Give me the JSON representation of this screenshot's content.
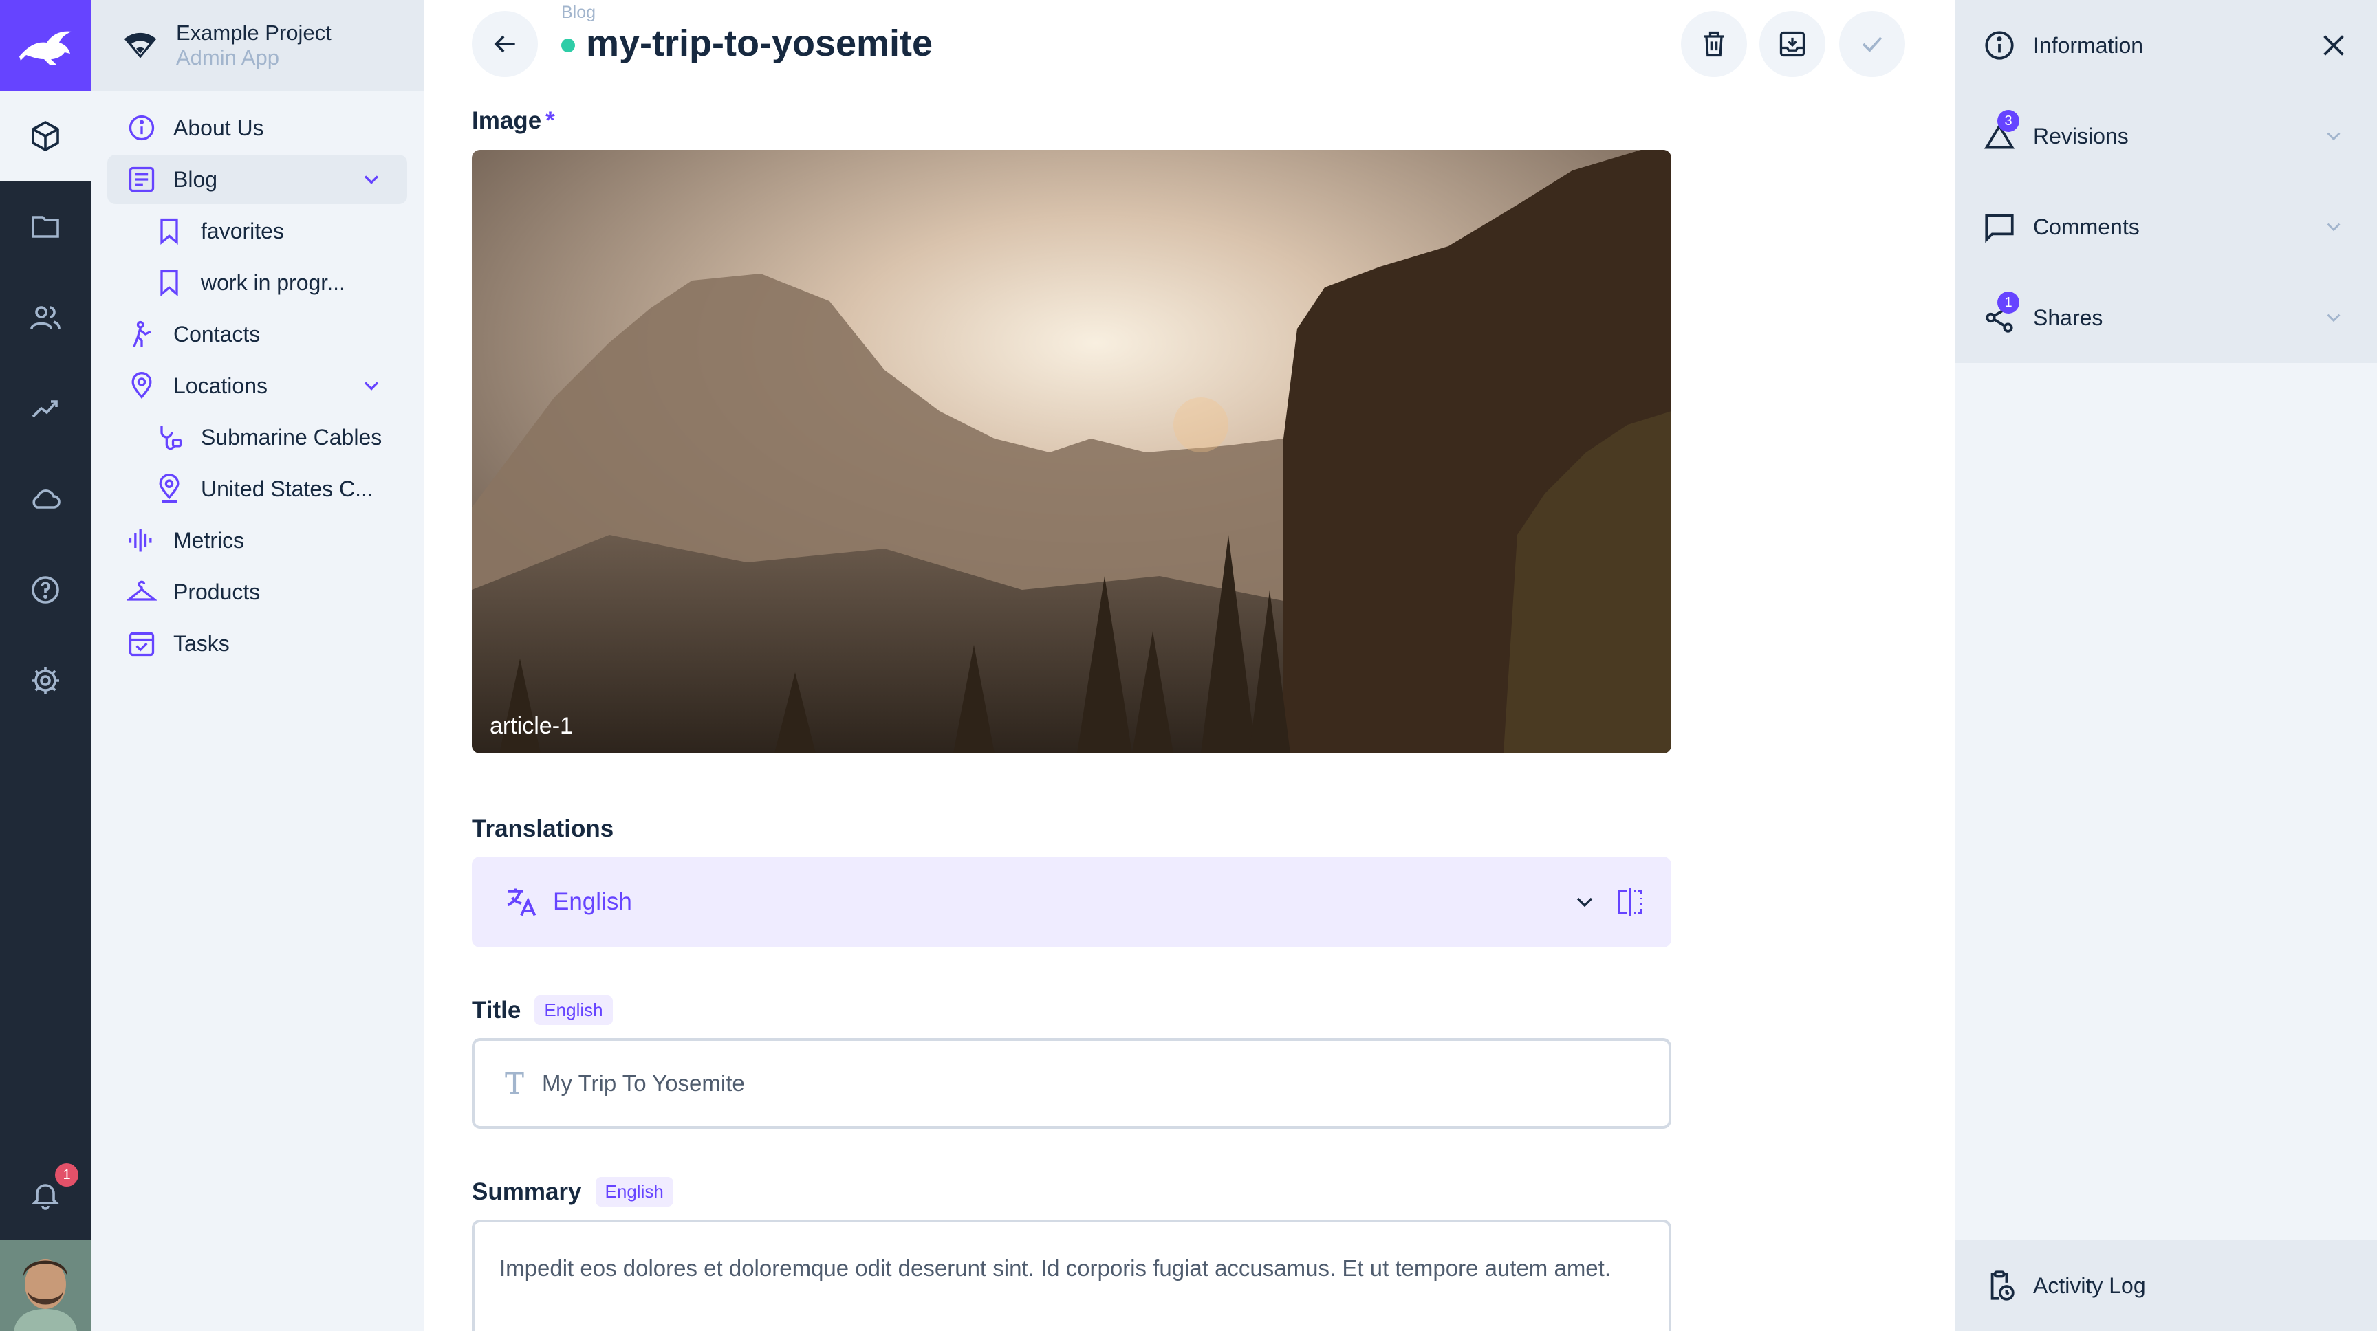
{
  "project": {
    "name": "Example Project",
    "subtitle": "Admin App"
  },
  "modules": [
    {
      "name": "content-module",
      "icon": "cube-icon",
      "active": true
    },
    {
      "name": "files-module",
      "icon": "folder-icon"
    },
    {
      "name": "users-module",
      "icon": "users-icon"
    },
    {
      "name": "insights-module",
      "icon": "insights-icon"
    },
    {
      "name": "cloud-module",
      "icon": "cloud-icon"
    },
    {
      "name": "help-module",
      "icon": "help-icon"
    },
    {
      "name": "settings-module",
      "icon": "gear-icon"
    }
  ],
  "notifications": {
    "count": "1"
  },
  "nav": {
    "items": [
      {
        "label": "About Us"
      },
      {
        "label": "Blog"
      },
      {
        "label": "favorites"
      },
      {
        "label": "work in progr..."
      },
      {
        "label": "Contacts"
      },
      {
        "label": "Locations"
      },
      {
        "label": "Submarine Cables"
      },
      {
        "label": "United States C..."
      },
      {
        "label": "Metrics"
      },
      {
        "label": "Products"
      },
      {
        "label": "Tasks"
      }
    ]
  },
  "header": {
    "breadcrumb": "Blog",
    "title": "my-trip-to-yosemite"
  },
  "form": {
    "image": {
      "label": "Image",
      "required_mark": "*",
      "caption": "article-1"
    },
    "translations": {
      "label": "Translations",
      "language": "English"
    },
    "title": {
      "label": "Title",
      "lang_badge": "English",
      "value": "My Trip To Yosemite"
    },
    "summary": {
      "label": "Summary",
      "lang_badge": "English",
      "value": "Impedit eos dolores et doloremque odit deserunt sint. Id corporis fugiat accusamus. Et ut tempore autem amet."
    }
  },
  "sidebar": {
    "information": "Information",
    "revisions": "Revisions",
    "revisions_count": "3",
    "comments": "Comments",
    "shares": "Shares",
    "shares_count": "1",
    "activity": "Activity Log"
  },
  "colors": {
    "accent": "#6644ff",
    "module_bar": "#1f2937",
    "status_published": "#2ecda7"
  }
}
